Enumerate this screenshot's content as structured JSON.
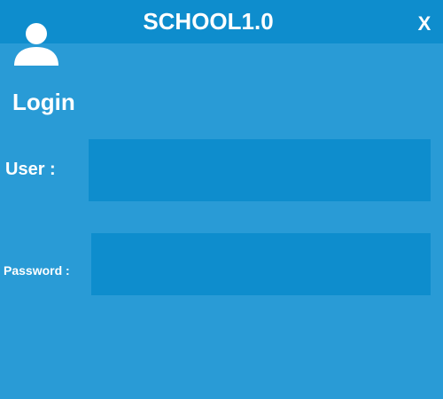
{
  "window": {
    "title": "SCHOOL1.0",
    "close_label": "X"
  },
  "icons": {
    "user": "user-avatar-icon"
  },
  "login": {
    "heading": "Login",
    "user_label": "User :",
    "user_value": "",
    "password_label": "Password :",
    "password_value": ""
  },
  "colors": {
    "background": "#299BD6",
    "titlebar": "#0E8DCD",
    "input_background": "#0E8DCD",
    "text": "#FFFFFF"
  }
}
